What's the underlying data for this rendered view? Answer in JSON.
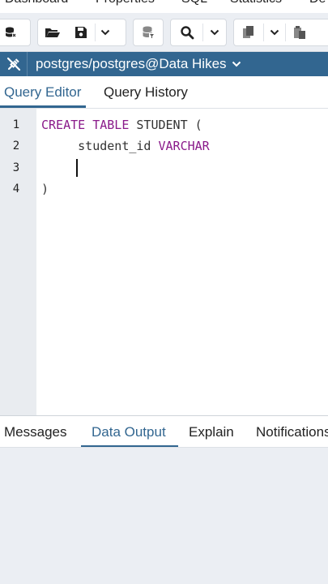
{
  "top_tabs": [
    "Dashboard",
    "Properties",
    "SQL",
    "Statistics",
    "De"
  ],
  "connection": {
    "label": "postgres/postgres@Data Hikes"
  },
  "editor_tabs": [
    {
      "label": "Query Editor",
      "active": true
    },
    {
      "label": "Query History",
      "active": false
    }
  ],
  "editor": {
    "line_numbers": [
      "1",
      "2",
      "3",
      "4"
    ],
    "lines": [
      {
        "keyword": "CREATE TABLE",
        "rest": " STUDENT ("
      },
      {
        "indent": "     ",
        "text": "student_id ",
        "type": "VARCHAR"
      },
      {
        "text": ""
      },
      {
        "text": ")"
      }
    ]
  },
  "bottom_tabs": [
    {
      "label": "Messages",
      "active": false
    },
    {
      "label": "Data Output",
      "active": true
    },
    {
      "label": "Explain",
      "active": false
    },
    {
      "label": "Notifications",
      "active": false
    }
  ],
  "colors": {
    "accent": "#326690",
    "keyword": "#8a1a8a",
    "toolbar_bg": "#ebeef3"
  }
}
